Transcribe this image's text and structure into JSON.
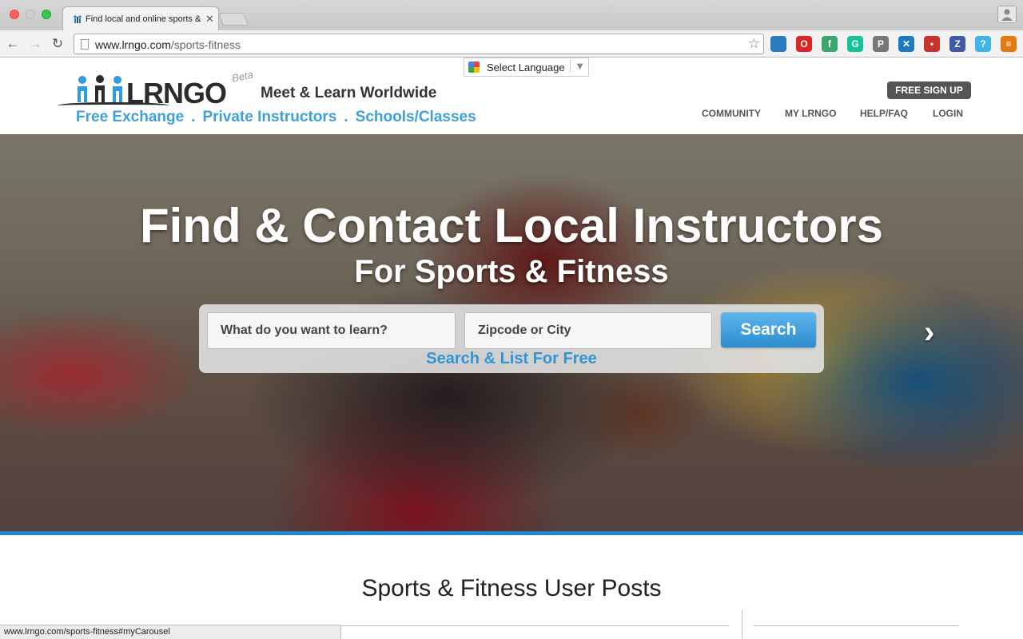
{
  "browser": {
    "tab_title": "Find local and online sports &",
    "tab_close": "✕",
    "url_domain": "www.lrngo.com",
    "url_path": "/sports-fitness",
    "status_url": "www.lrngo.com/sports-fitness#myCarousel",
    "extensions": [
      {
        "icon": "new-badge-icon",
        "glyph": "",
        "color": "#2a7bbf"
      },
      {
        "icon": "opera-icon",
        "glyph": "O",
        "color": "#e02424"
      },
      {
        "icon": "feedly-icon",
        "glyph": "f",
        "color": "#3aa86b"
      },
      {
        "icon": "grammarly-icon",
        "glyph": "G",
        "color": "#15c39a"
      },
      {
        "icon": "pocket-icon",
        "glyph": "P",
        "color": "#777777"
      },
      {
        "icon": "bookmark-ext-icon",
        "glyph": "✕",
        "color": "#1e79c3"
      },
      {
        "icon": "signal-ext-icon",
        "glyph": "•",
        "color": "#c8342d"
      },
      {
        "icon": "zotero-icon",
        "glyph": "Z",
        "color": "#3e5aa8"
      },
      {
        "icon": "help-ext-icon",
        "glyph": "?",
        "color": "#3fb4e8"
      },
      {
        "icon": "menu-icon",
        "glyph": "≡",
        "color": "#e57a12"
      }
    ]
  },
  "header": {
    "language": "Select Language",
    "brand": "LRNGO",
    "beta": "Beta",
    "tagline": "Meet & Learn Worldwide",
    "links": [
      "Free Exchange",
      "Private Instructors",
      "Schools/Classes"
    ],
    "link_separator": ".",
    "signup": "FREE SIGN UP",
    "nav": [
      "COMMUNITY",
      "MY LRNGO",
      "HELP/FAQ",
      "LOGIN"
    ]
  },
  "hero": {
    "title": "Find & Contact Local Instructors",
    "subtitle": "For Sports & Fitness",
    "search_placeholder": "What do you want to learn?",
    "location_placeholder": "Zipcode or City",
    "search_button": "Search",
    "search_free": "Search & List For Free"
  },
  "posts": {
    "title": "Sports & Fitness User Posts"
  },
  "colors": {
    "accent_blue": "#3fa0d8",
    "hero_bar": "#1e88d2",
    "signup_bg": "#555555"
  }
}
